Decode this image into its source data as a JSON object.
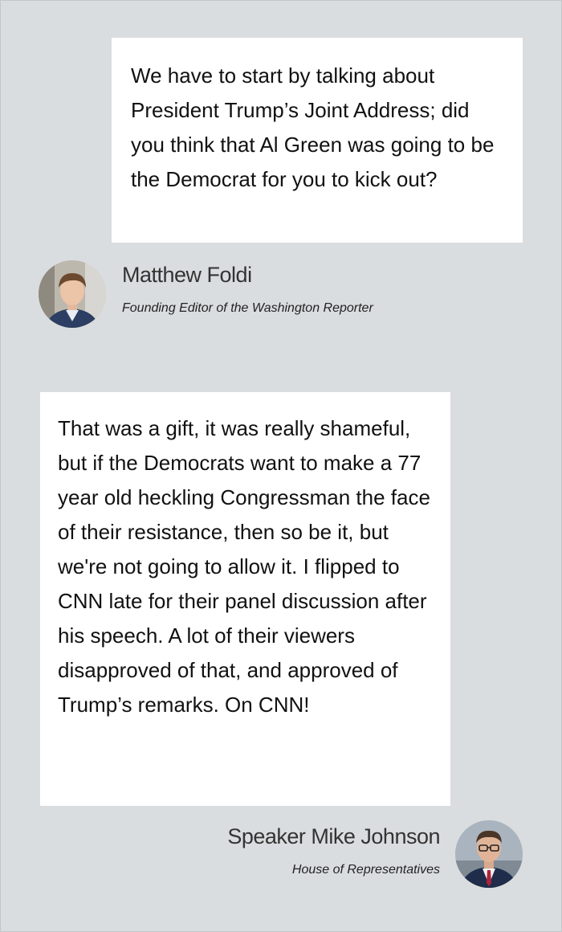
{
  "question": {
    "text": "We have to start by talking about President Trump’s Joint Address; did you think that Al Green was going to be the Democrat for you to kick out?"
  },
  "interviewer": {
    "name": "Matthew Foldi",
    "title": "Founding Editor of the Washington Reporter"
  },
  "answer": {
    "text": "That was a gift, it was really shameful, but if the Democrats want to make a 77 year old heckling Congressman the face of their resistance, then so be it, but we're not going to allow it. I flipped to CNN late for their panel discussion after his speech. A lot of their viewers disapproved of that, and approved of Trump’s remarks. On CNN!"
  },
  "respondent": {
    "name": "Speaker Mike Johnson",
    "title": "House of Representatives"
  },
  "colors": {
    "background": "#dadddf",
    "bubble": "#ffffff",
    "text": "#111111"
  }
}
